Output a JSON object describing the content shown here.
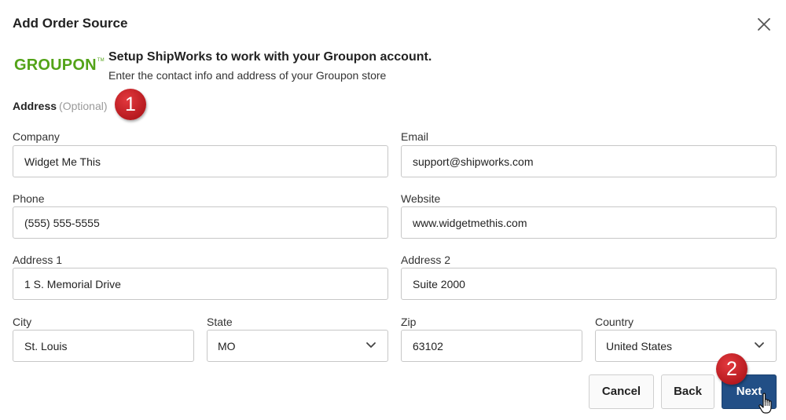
{
  "dialog": {
    "title": "Add Order Source",
    "close_icon": "close-icon"
  },
  "store": {
    "logo_text": "GROUPON",
    "logo_tm": "TM",
    "brand_color": "#53a318",
    "heading": "Setup ShipWorks to work with your Groupon account.",
    "subheading": "Enter the contact info and address of your Groupon store"
  },
  "section": {
    "label": "Address",
    "optional": "(Optional)"
  },
  "fields": {
    "company": {
      "label": "Company",
      "value": "Widget Me This"
    },
    "email": {
      "label": "Email",
      "value": "support@shipworks.com"
    },
    "phone": {
      "label": "Phone",
      "value": "(555) 555-5555"
    },
    "website": {
      "label": "Website",
      "value": "www.widgetmethis.com"
    },
    "address1": {
      "label": "Address 1",
      "value": "1 S. Memorial Drive"
    },
    "address2": {
      "label": "Address 2",
      "value": "Suite 2000"
    },
    "city": {
      "label": "City",
      "value": "St. Louis"
    },
    "state": {
      "label": "State",
      "value": "MO",
      "icon": "chevron-down-icon"
    },
    "zip": {
      "label": "Zip",
      "value": "63102"
    },
    "country": {
      "label": "Country",
      "value": "United States",
      "icon": "chevron-down-icon"
    }
  },
  "buttons": {
    "cancel": "Cancel",
    "back": "Back",
    "next": "Next",
    "next_color": "#224f86"
  },
  "annotations": {
    "step1": "1",
    "step2": "2",
    "color": "#c8232a"
  },
  "cursor_icon": "hand-pointer-icon"
}
